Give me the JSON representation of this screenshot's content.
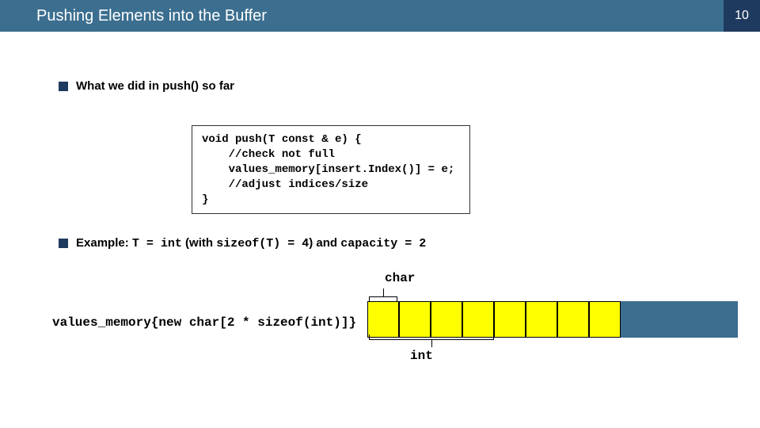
{
  "header": {
    "title": "Pushing Elements into the Buffer",
    "page_number": "10"
  },
  "bullets": {
    "b1": "What we did in push() so far",
    "b2_prefix": "Example: ",
    "b2_mono1": "T = int",
    "b2_mid": " (with ",
    "b2_mono2": "sizeof(T) = 4",
    "b2_mid2": ") and ",
    "b2_mono3": "capacity = 2"
  },
  "code": {
    "l1": "void push(T const & e) {",
    "l2": "    //check not full",
    "l3": "    values_memory[insert.Index()] = e;",
    "l4": "    //adjust indices/size",
    "l5": "}"
  },
  "labels": {
    "char": "char",
    "int": "int",
    "mem_expr": "values_memory{new char[2 * sizeof(int)]}"
  },
  "chart_data": {
    "type": "table",
    "description": "Memory layout: 8 char-sized yellow cells (2 * sizeof(int) = 8 bytes) followed by a blue block. 'char' brackets span one cell; 'int' brackets span four cells.",
    "yellow_cells": 8,
    "char_span_cells": 1,
    "int_span_cells": 4
  }
}
